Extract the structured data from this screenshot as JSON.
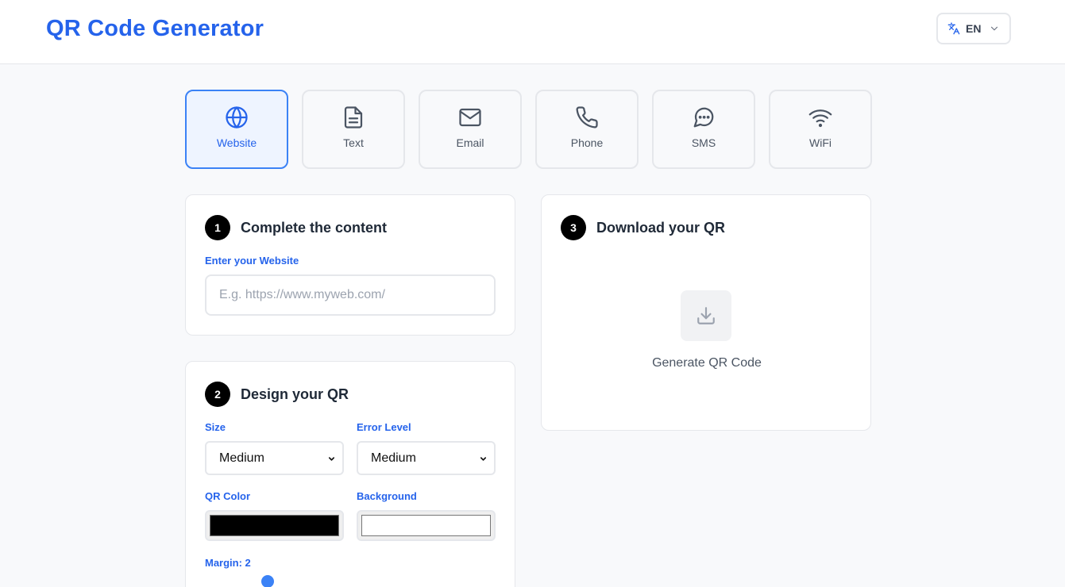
{
  "header": {
    "title": "QR Code Generator",
    "language": "EN"
  },
  "types": [
    {
      "label": "Website",
      "icon": "globe-icon",
      "active": true
    },
    {
      "label": "Text",
      "icon": "document-icon",
      "active": false
    },
    {
      "label": "Email",
      "icon": "mail-icon",
      "active": false
    },
    {
      "label": "Phone",
      "icon": "phone-icon",
      "active": false
    },
    {
      "label": "SMS",
      "icon": "chat-icon",
      "active": false
    },
    {
      "label": "WiFi",
      "icon": "wifi-icon",
      "active": false
    }
  ],
  "content": {
    "step": "1",
    "title": "Complete the content",
    "field_label": "Enter your Website",
    "placeholder": "E.g. https://www.myweb.com/",
    "value": ""
  },
  "design": {
    "step": "2",
    "title": "Design your QR",
    "size_label": "Size",
    "size_value": "Medium",
    "error_label": "Error Level",
    "error_value": "Medium",
    "qr_color_label": "QR Color",
    "qr_color": "#000000",
    "background_label": "Background",
    "background_color": "#ffffff",
    "margin_label": "Margin: 2",
    "margin_value": 2
  },
  "download": {
    "step": "3",
    "title": "Download your QR",
    "generate_label": "Generate QR Code"
  },
  "colors": {
    "accent": "#2563eb",
    "active_bg": "#eef4ff",
    "slider": "#3b82f6"
  }
}
